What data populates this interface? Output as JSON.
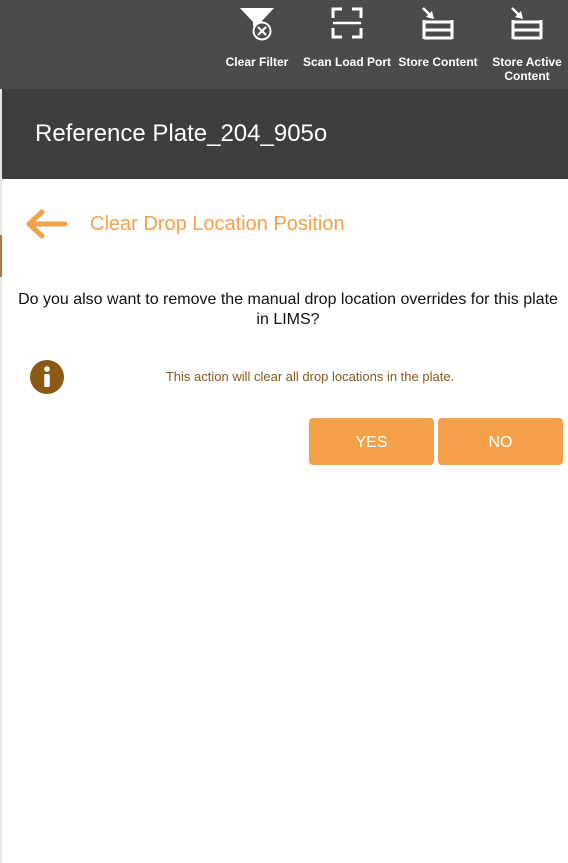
{
  "toolbar": {
    "items": [
      {
        "label": "Clear Filter",
        "icon": "filter-clear-icon"
      },
      {
        "label": "Scan Load Port",
        "icon": "scan-icon"
      },
      {
        "label": "Store Content",
        "icon": "store-icon"
      },
      {
        "label": "Store Active Content",
        "icon": "store-active-icon"
      }
    ]
  },
  "header": {
    "title": "Reference Plate_204_905o"
  },
  "dialog": {
    "title": "Clear Drop Location Position",
    "question": "Do you also want to remove the manual drop location overrides for this plate in LIMS?",
    "info": "This action will clear all drop locations in the plate.",
    "yes_label": "YES",
    "no_label": "NO"
  },
  "colors": {
    "toolbar_bg": "#4b4b4b",
    "title_bg": "#3e3e3e",
    "accent": "#f4a14a",
    "info_icon": "#8a5a14",
    "info_text": "#8a5a14"
  }
}
